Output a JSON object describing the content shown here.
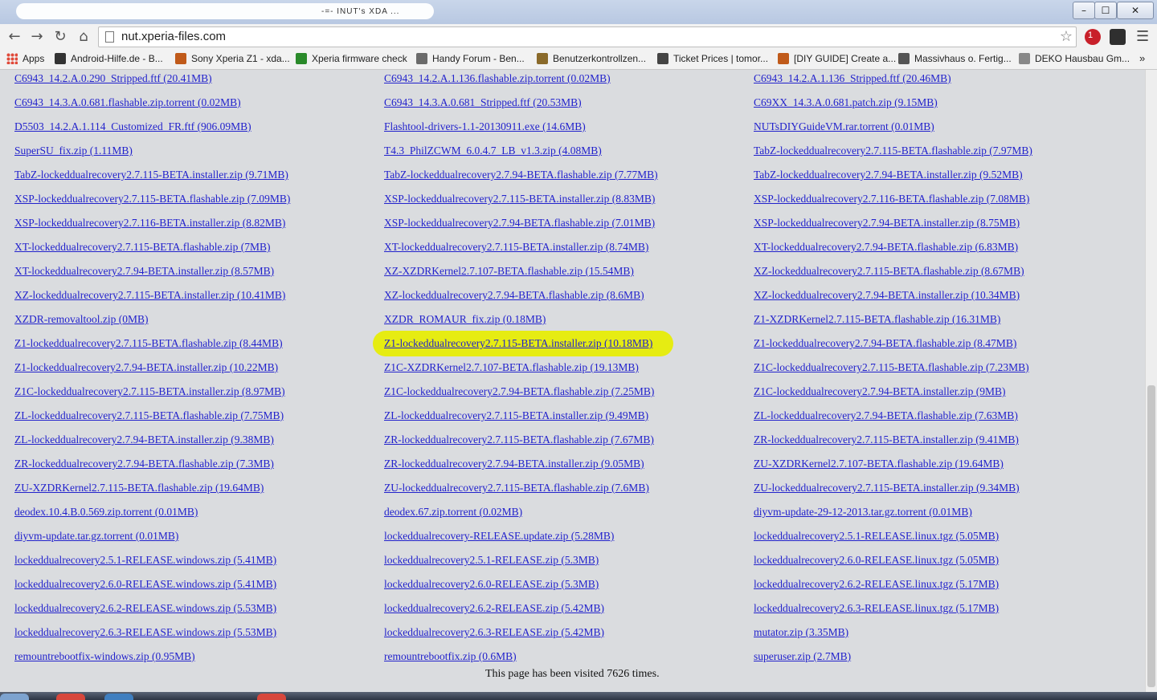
{
  "window": {
    "title": "-=- INUT's XDA ...",
    "controls": {
      "minimize": "–",
      "maximize": "☐",
      "close": "✕"
    }
  },
  "toolbar": {
    "back_icon": "←",
    "forward_icon": "→",
    "reload_icon": "↻",
    "home_icon": "⌂",
    "url": "nut.xperia-files.com",
    "star_icon": "☆",
    "ext1_badge": "1",
    "menu_icon": "☰"
  },
  "bookmarks": [
    {
      "label": "Apps",
      "color": "#e04a3a"
    },
    {
      "label": "Android-Hilfe.de - B...",
      "color": "#333333"
    },
    {
      "label": "Sony Xperia Z1 - xda...",
      "color": "#c05a1a"
    },
    {
      "label": "Xperia firmware check",
      "color": "#2a8a2a"
    },
    {
      "label": "Handy Forum - Ben...",
      "color": "#6a6a6a"
    },
    {
      "label": "Benutzerkontrollzen...",
      "color": "#8a6a2a"
    },
    {
      "label": "Ticket Prices | tomor...",
      "color": "#444444"
    },
    {
      "label": "[DIY GUIDE] Create a...",
      "color": "#c05a1a"
    },
    {
      "label": "Massivhaus o. Fertig...",
      "color": "#555555"
    },
    {
      "label": "DEKO Hausbau Gm...",
      "color": "#888888"
    }
  ],
  "bookmarks_more": "»",
  "files": [
    [
      "C6943_14.2.A.0.290_Stripped.ftf (20.41MB)",
      "C6943_14.2.A.1.136.flashable.zip.torrent (0.02MB)",
      "C6943_14.2.A.1.136_Stripped.ftf (20.46MB)"
    ],
    [
      "C6943_14.3.A.0.681.flashable.zip.torrent (0.02MB)",
      "C6943_14.3.A.0.681_Stripped.ftf (20.53MB)",
      "C69XX_14.3.A.0.681.patch.zip (9.15MB)"
    ],
    [
      "D5503_14.2.A.1.114_Customized_FR.ftf (906.09MB)",
      "Flashtool-drivers-1.1-20130911.exe (14.6MB)",
      "NUTsDIYGuideVM.rar.torrent (0.01MB)"
    ],
    [
      "SuperSU_fix.zip (1.11MB)",
      "T4.3_PhilZCWM_6.0.4.7_LB_v1.3.zip (4.08MB)",
      "TabZ-lockeddualrecovery2.7.115-BETA.flashable.zip (7.97MB)"
    ],
    [
      "TabZ-lockeddualrecovery2.7.115-BETA.installer.zip (9.71MB)",
      "TabZ-lockeddualrecovery2.7.94-BETA.flashable.zip (7.77MB)",
      "TabZ-lockeddualrecovery2.7.94-BETA.installer.zip (9.52MB)"
    ],
    [
      "XSP-lockeddualrecovery2.7.115-BETA.flashable.zip (7.09MB)",
      "XSP-lockeddualrecovery2.7.115-BETA.installer.zip (8.83MB)",
      "XSP-lockeddualrecovery2.7.116-BETA.flashable.zip (7.08MB)"
    ],
    [
      "XSP-lockeddualrecovery2.7.116-BETA.installer.zip (8.82MB)",
      "XSP-lockeddualrecovery2.7.94-BETA.flashable.zip (7.01MB)",
      "XSP-lockeddualrecovery2.7.94-BETA.installer.zip (8.75MB)"
    ],
    [
      "XT-lockeddualrecovery2.7.115-BETA.flashable.zip (7MB)",
      "XT-lockeddualrecovery2.7.115-BETA.installer.zip (8.74MB)",
      "XT-lockeddualrecovery2.7.94-BETA.flashable.zip (6.83MB)"
    ],
    [
      "XT-lockeddualrecovery2.7.94-BETA.installer.zip (8.57MB)",
      "XZ-XZDRKernel2.7.107-BETA.flashable.zip (15.54MB)",
      "XZ-lockeddualrecovery2.7.115-BETA.flashable.zip (8.67MB)"
    ],
    [
      "XZ-lockeddualrecovery2.7.115-BETA.installer.zip (10.41MB)",
      "XZ-lockeddualrecovery2.7.94-BETA.flashable.zip (8.6MB)",
      "XZ-lockeddualrecovery2.7.94-BETA.installer.zip (10.34MB)"
    ],
    [
      "XZDR-removaltool.zip (0MB)",
      "XZDR_ROMAUR_fix.zip (0.18MB)",
      "Z1-XZDRKernel2.7.115-BETA.flashable.zip (16.31MB)"
    ],
    [
      "Z1-lockeddualrecovery2.7.115-BETA.flashable.zip (8.44MB)",
      "Z1-lockeddualrecovery2.7.115-BETA.installer.zip (10.18MB)",
      "Z1-lockeddualrecovery2.7.94-BETA.flashable.zip (8.47MB)"
    ],
    [
      "Z1-lockeddualrecovery2.7.94-BETA.installer.zip (10.22MB)",
      "Z1C-XZDRKernel2.7.107-BETA.flashable.zip (19.13MB)",
      "Z1C-lockeddualrecovery2.7.115-BETA.flashable.zip (7.23MB)"
    ],
    [
      "Z1C-lockeddualrecovery2.7.115-BETA.installer.zip (8.97MB)",
      "Z1C-lockeddualrecovery2.7.94-BETA.flashable.zip (7.25MB)",
      "Z1C-lockeddualrecovery2.7.94-BETA.installer.zip (9MB)"
    ],
    [
      "ZL-lockeddualrecovery2.7.115-BETA.flashable.zip (7.75MB)",
      "ZL-lockeddualrecovery2.7.115-BETA.installer.zip (9.49MB)",
      "ZL-lockeddualrecovery2.7.94-BETA.flashable.zip (7.63MB)"
    ],
    [
      "ZL-lockeddualrecovery2.7.94-BETA.installer.zip (9.38MB)",
      "ZR-lockeddualrecovery2.7.115-BETA.flashable.zip (7.67MB)",
      "ZR-lockeddualrecovery2.7.115-BETA.installer.zip (9.41MB)"
    ],
    [
      "ZR-lockeddualrecovery2.7.94-BETA.flashable.zip (7.3MB)",
      "ZR-lockeddualrecovery2.7.94-BETA.installer.zip (9.05MB)",
      "ZU-XZDRKernel2.7.107-BETA.flashable.zip (19.64MB)"
    ],
    [
      "ZU-XZDRKernel2.7.115-BETA.flashable.zip (19.64MB)",
      "ZU-lockeddualrecovery2.7.115-BETA.flashable.zip (7.6MB)",
      "ZU-lockeddualrecovery2.7.115-BETA.installer.zip (9.34MB)"
    ],
    [
      "deodex.10.4.B.0.569.zip.torrent (0.01MB)",
      "deodex.67.zip.torrent (0.02MB)",
      "diyvm-update-29-12-2013.tar.gz.torrent (0.01MB)"
    ],
    [
      "diyvm-update.tar.gz.torrent (0.01MB)",
      "lockeddualrecovery-RELEASE.update.zip (5.28MB)",
      "lockeddualrecovery2.5.1-RELEASE.linux.tgz (5.05MB)"
    ],
    [
      "lockeddualrecovery2.5.1-RELEASE.windows.zip (5.41MB)",
      "lockeddualrecovery2.5.1-RELEASE.zip (5.3MB)",
      "lockeddualrecovery2.6.0-RELEASE.linux.tgz (5.05MB)"
    ],
    [
      "lockeddualrecovery2.6.0-RELEASE.windows.zip (5.41MB)",
      "lockeddualrecovery2.6.0-RELEASE.zip (5.3MB)",
      "lockeddualrecovery2.6.2-RELEASE.linux.tgz (5.17MB)"
    ],
    [
      "lockeddualrecovery2.6.2-RELEASE.windows.zip (5.53MB)",
      "lockeddualrecovery2.6.2-RELEASE.zip (5.42MB)",
      "lockeddualrecovery2.6.3-RELEASE.linux.tgz (5.17MB)"
    ],
    [
      "lockeddualrecovery2.6.3-RELEASE.windows.zip (5.53MB)",
      "lockeddualrecovery2.6.3-RELEASE.zip (5.42MB)",
      "mutator.zip (3.35MB)"
    ],
    [
      "remountrebootfix-windows.zip (0.95MB)",
      "remountrebootfix.zip (0.6MB)",
      "superuser.zip (2.7MB)"
    ]
  ],
  "highlighted_file": "Z1-lockeddualrecovery2.7.115-BETA.installer.zip (10.18MB)",
  "highlight_color": "#e6ec12",
  "link_color": "#2222cc",
  "visit_counter": "This page has been visited 7626 times."
}
